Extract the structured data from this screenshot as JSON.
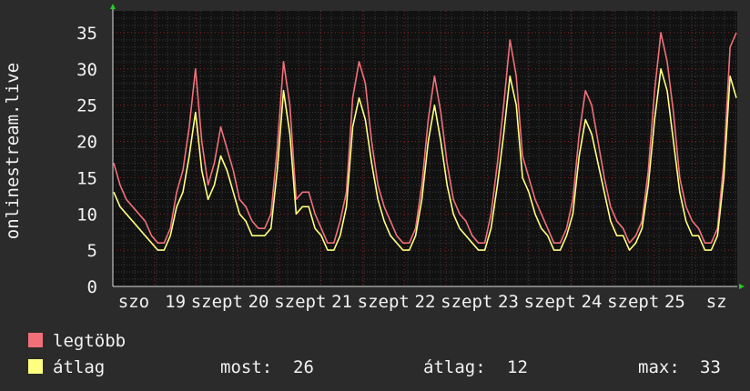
{
  "chart_data": {
    "type": "line",
    "ylabel": "onlinestream.live",
    "ylim": [
      0,
      38
    ],
    "yticks": [
      0,
      5,
      10,
      15,
      20,
      25,
      30,
      35
    ],
    "grid": true,
    "x_tick_labels": [
      "szo",
      "19",
      "szept",
      "20",
      "szept",
      "21",
      "szept",
      "22",
      "szept",
      "23",
      "szept",
      "24",
      "szept",
      "25",
      "sz"
    ],
    "series": [
      {
        "name": "legtöbb",
        "color": "#f0707a",
        "values": [
          17,
          14,
          12,
          11,
          10,
          9,
          7,
          6,
          6,
          8,
          13,
          16,
          22,
          30,
          20,
          14,
          17,
          22,
          19,
          16,
          12,
          11,
          9,
          8,
          8,
          10,
          19,
          31,
          25,
          12,
          13,
          13,
          10,
          8,
          6,
          6,
          9,
          13,
          26,
          31,
          28,
          20,
          14,
          11,
          9,
          7,
          6,
          6,
          8,
          14,
          23,
          29,
          24,
          17,
          12,
          10,
          9,
          7,
          6,
          6,
          10,
          17,
          25,
          34,
          29,
          18,
          15,
          12,
          10,
          8,
          6,
          6,
          8,
          12,
          21,
          27,
          25,
          20,
          15,
          11,
          9,
          8,
          6,
          7,
          9,
          16,
          27,
          35,
          31,
          24,
          15,
          11,
          9,
          8,
          6,
          6,
          8,
          17,
          33,
          35
        ]
      },
      {
        "name": "átlag",
        "color": "#ffff80",
        "values": [
          13,
          11,
          10,
          9,
          8,
          7,
          6,
          5,
          5,
          7,
          11,
          13,
          18,
          24,
          16,
          12,
          14,
          18,
          16,
          13,
          10,
          9,
          7,
          7,
          7,
          8,
          16,
          27,
          21,
          10,
          11,
          11,
          8,
          7,
          5,
          5,
          7,
          11,
          22,
          26,
          23,
          17,
          12,
          9,
          7,
          6,
          5,
          5,
          7,
          12,
          20,
          25,
          20,
          14,
          10,
          8,
          7,
          6,
          5,
          5,
          8,
          14,
          21,
          29,
          25,
          15,
          13,
          10,
          8,
          7,
          5,
          5,
          7,
          10,
          18,
          23,
          21,
          17,
          13,
          9,
          7,
          7,
          5,
          6,
          8,
          14,
          23,
          30,
          27,
          20,
          13,
          9,
          7,
          7,
          5,
          5,
          7,
          15,
          29,
          26
        ]
      }
    ],
    "legend": {
      "placement": "bottom-left",
      "items": [
        "legtöbb",
        "átlag"
      ]
    },
    "stats": {
      "most_label": "most:",
      "most_value": "26",
      "avg_label": "átlag:",
      "avg_value": "12",
      "max_label": "max:",
      "max_value": "33"
    },
    "colors": {
      "background": "#2b2b2b",
      "plot_background": "#111111",
      "grid_minor": "#3a3a3a",
      "grid_major": "#8b2020",
      "axis_arrow": "#22cc22",
      "text": "#f2f2f2"
    }
  }
}
